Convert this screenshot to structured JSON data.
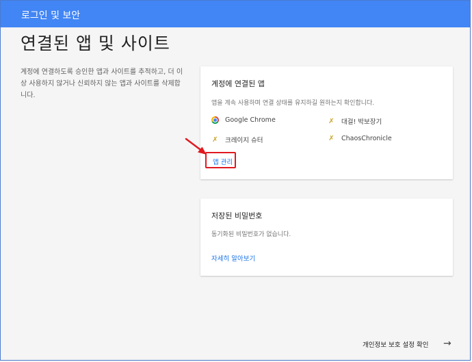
{
  "header": {
    "title": "로그인 및 보안"
  },
  "page": {
    "title": "연결된 앱 및 사이트",
    "description": "계정에 연결하도록 승인한 앱과 사이트를 추적하고, 더 이상 사용하지 않거나 신뢰하지 않는 앱과 사이트를 삭제합니다."
  },
  "connected_apps": {
    "title": "계정에 연결된 앱",
    "subtitle": "앱을 계속 사용하며 연결 상태를 유지하길 원하는지 확인합니다.",
    "apps": [
      {
        "name": "Google Chrome",
        "icon": "chrome-icon"
      },
      {
        "name": "대걸! 박보장기",
        "icon": "wand-icon"
      },
      {
        "name": "크레이지 슈터",
        "icon": "wand-icon"
      },
      {
        "name": "ChaosChronicle",
        "icon": "wand-icon"
      }
    ],
    "manage_label": "앱 관리",
    "highlight_color": "#e0191f"
  },
  "saved_passwords": {
    "title": "저장된 비밀번호",
    "subtitle": "동기화된 비밀번호가 없습니다.",
    "learn_more": "자세히 알아보기"
  },
  "footer": {
    "privacy_link": "개인정보 보호 설정 확인",
    "arrow": "→"
  },
  "colors": {
    "accent": "#4285f4",
    "link": "#1a73e8"
  }
}
